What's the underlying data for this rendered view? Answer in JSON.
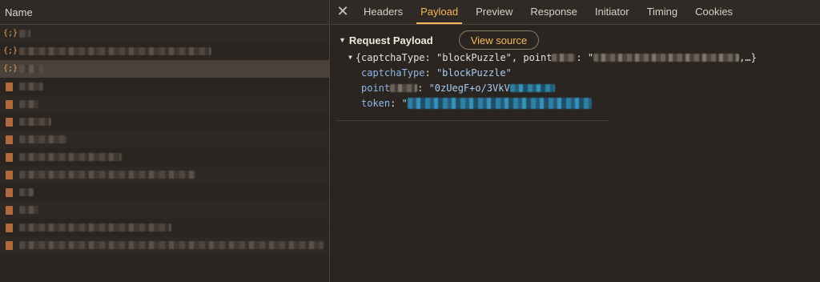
{
  "left_panel": {
    "header": "Name",
    "rows": [
      {
        "icon": "{;}",
        "kind": "json",
        "blur_width": 14
      },
      {
        "icon": "{;}",
        "kind": "json",
        "blur_width": 240
      },
      {
        "icon": "{;}",
        "kind": "json",
        "blur_width": 30,
        "selected": true
      },
      {
        "icon": "",
        "kind": "doc",
        "blur_width": 30
      },
      {
        "icon": "",
        "kind": "doc",
        "blur_width": 24
      },
      {
        "icon": "",
        "kind": "doc",
        "blur_width": 40
      },
      {
        "icon": "",
        "kind": "doc",
        "blur_width": 60
      },
      {
        "icon": "",
        "kind": "doc",
        "blur_width": 128
      },
      {
        "icon": "",
        "kind": "doc",
        "blur_width": 220
      },
      {
        "icon": "",
        "kind": "doc",
        "blur_width": 18
      },
      {
        "icon": "",
        "kind": "doc",
        "blur_width": 24
      },
      {
        "icon": "",
        "kind": "doc",
        "blur_width": 190
      },
      {
        "icon": "",
        "kind": "doc",
        "blur_width": 380
      }
    ]
  },
  "tabs": [
    "Headers",
    "Payload",
    "Preview",
    "Response",
    "Initiator",
    "Timing",
    "Cookies"
  ],
  "active_tab": "Payload",
  "payload": {
    "section_title": "Request Payload",
    "view_source": "View source",
    "summary_prefix": "{captchaType: \"blockPuzzle\", point",
    "summary_mid": ": \"",
    "summary_suffix": ",…}",
    "props": [
      {
        "key": "captchaType",
        "sep": ": ",
        "value": "\"blockPuzzle\""
      },
      {
        "key": "point",
        "sep": ": ",
        "value": "\"0zUegF+o/3VkV"
      },
      {
        "key": "token",
        "sep": ": ",
        "value": "\""
      }
    ]
  },
  "colors": {
    "accent": "#f6b65c",
    "key": "#8fb7ea",
    "string": "#a9cdf4",
    "background": "#2a2520"
  }
}
